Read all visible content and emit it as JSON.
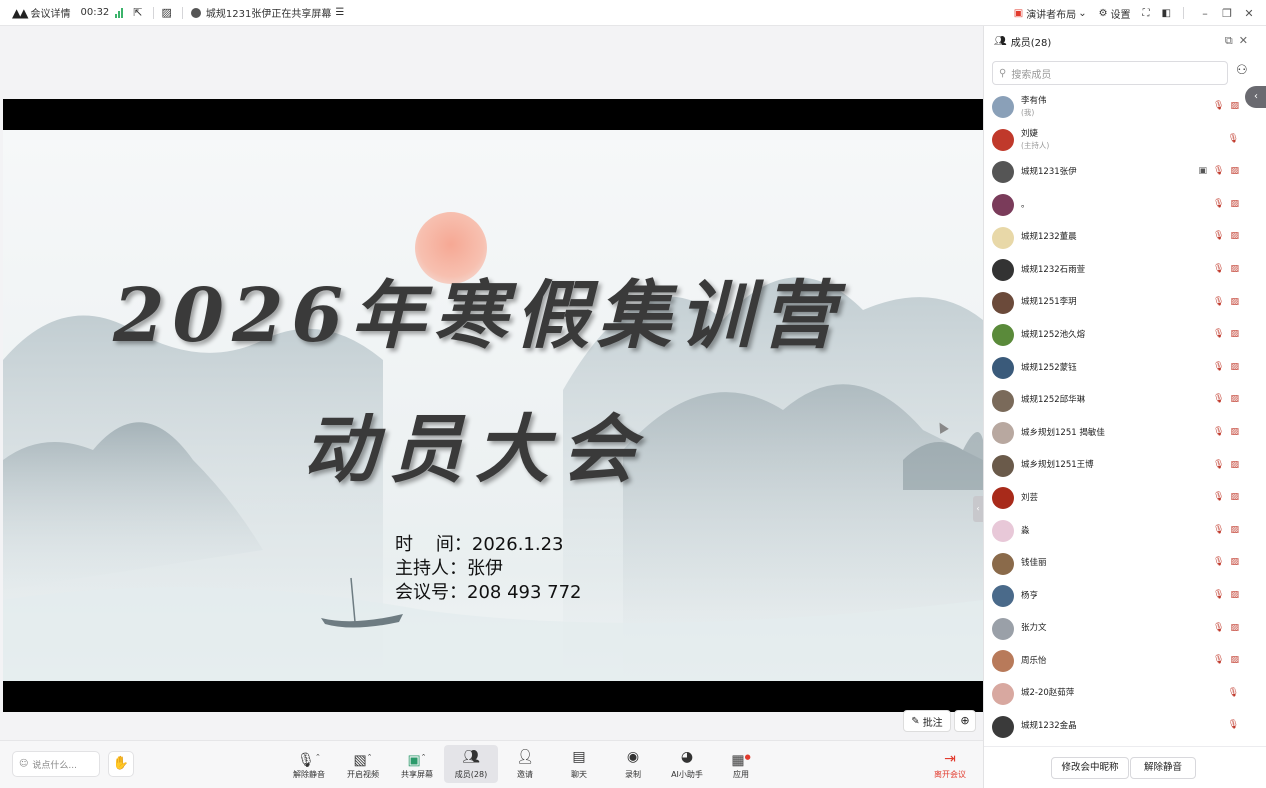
{
  "topbar": {
    "meeting_details": "会议详情",
    "elapsed": "00:32",
    "sharing_status": "城规1231张伊正在共享屏幕",
    "presenter_layout": "演讲者布局",
    "settings": "设置"
  },
  "slide": {
    "title_line1": "2026年寒假集训营",
    "title_line2": "动员大会",
    "time_line": "时    间：2026.1.23",
    "host_line": "主持人：张伊",
    "meeting_id_line": "会议号：208 493 772"
  },
  "share_controls": {
    "annotate": "批注"
  },
  "bottombar": {
    "chat_placeholder": "说点什么...",
    "tools": [
      {
        "label": "解除静音",
        "icon": "mic-off-icon"
      },
      {
        "label": "开启视频",
        "icon": "camera-off-icon"
      },
      {
        "label": "共享屏幕",
        "icon": "share-screen-icon"
      },
      {
        "label": "成员(28)",
        "icon": "members-icon"
      },
      {
        "label": "邀请",
        "icon": "invite-icon"
      },
      {
        "label": "聊天",
        "icon": "chat-icon"
      },
      {
        "label": "录制",
        "icon": "record-icon"
      },
      {
        "label": "AI小助手",
        "icon": "ai-assistant-icon"
      },
      {
        "label": "应用",
        "icon": "apps-icon"
      }
    ],
    "leave": "离开会议"
  },
  "panel": {
    "title": "成员(28)",
    "search_placeholder": "搜索成员",
    "members": [
      {
        "name": "李有伟",
        "role": "(我)",
        "avatar_color": "#8aa0b8",
        "screen": false,
        "cam": true
      },
      {
        "name": "刘婕",
        "role": "(主持人)",
        "avatar_color": "#c0392b",
        "screen": false,
        "cam": false
      },
      {
        "name": "城规1231张伊",
        "role": "",
        "avatar_color": "#555555",
        "screen": true,
        "cam": true
      },
      {
        "name": "。",
        "role": "",
        "avatar_color": "#7a3b5a",
        "screen": false,
        "cam": true
      },
      {
        "name": "城规1232董晨",
        "role": "",
        "avatar_color": "#e8d8a8",
        "screen": false,
        "cam": true
      },
      {
        "name": "城规1232石雨萱",
        "role": "",
        "avatar_color": "#333333",
        "screen": false,
        "cam": true
      },
      {
        "name": "城规1251李玥",
        "role": "",
        "avatar_color": "#6b4a3a",
        "screen": false,
        "cam": true
      },
      {
        "name": "城规1252池久熔",
        "role": "",
        "avatar_color": "#5a8a3a",
        "screen": false,
        "cam": true
      },
      {
        "name": "城规1252蒙钰",
        "role": "",
        "avatar_color": "#3a5a7a",
        "screen": false,
        "cam": true
      },
      {
        "name": "城规1252邱华琳",
        "role": "",
        "avatar_color": "#7a6a5a",
        "screen": false,
        "cam": true
      },
      {
        "name": "城乡规划1251 揭敏佳",
        "role": "",
        "avatar_color": "#b8a8a0",
        "screen": false,
        "cam": true
      },
      {
        "name": "城乡规划1251王博",
        "role": "",
        "avatar_color": "#6a5a4a",
        "screen": false,
        "cam": true
      },
      {
        "name": "刘芸",
        "role": "",
        "avatar_color": "#a82a1a",
        "screen": false,
        "cam": true
      },
      {
        "name": "淼",
        "role": "",
        "avatar_color": "#e8c8d8",
        "screen": false,
        "cam": true
      },
      {
        "name": "钱佳丽",
        "role": "",
        "avatar_color": "#8a6a4a",
        "screen": false,
        "cam": true
      },
      {
        "name": "杨亨",
        "role": "",
        "avatar_color": "#4a6a8a",
        "screen": false,
        "cam": true
      },
      {
        "name": "张力文",
        "role": "",
        "avatar_color": "#9aa0a8",
        "screen": false,
        "cam": true
      },
      {
        "name": "周乐怡",
        "role": "",
        "avatar_color": "#b87a5a",
        "screen": false,
        "cam": true
      },
      {
        "name": "城2-20赵茹萍",
        "role": "",
        "avatar_color": "#d8a8a0",
        "screen": false,
        "cam": false
      },
      {
        "name": "城规1232金晶",
        "role": "",
        "avatar_color": "#3a3a3a",
        "screen": false,
        "cam": false
      }
    ],
    "rename_button": "修改会中昵称",
    "unmute_button": "解除静音"
  }
}
